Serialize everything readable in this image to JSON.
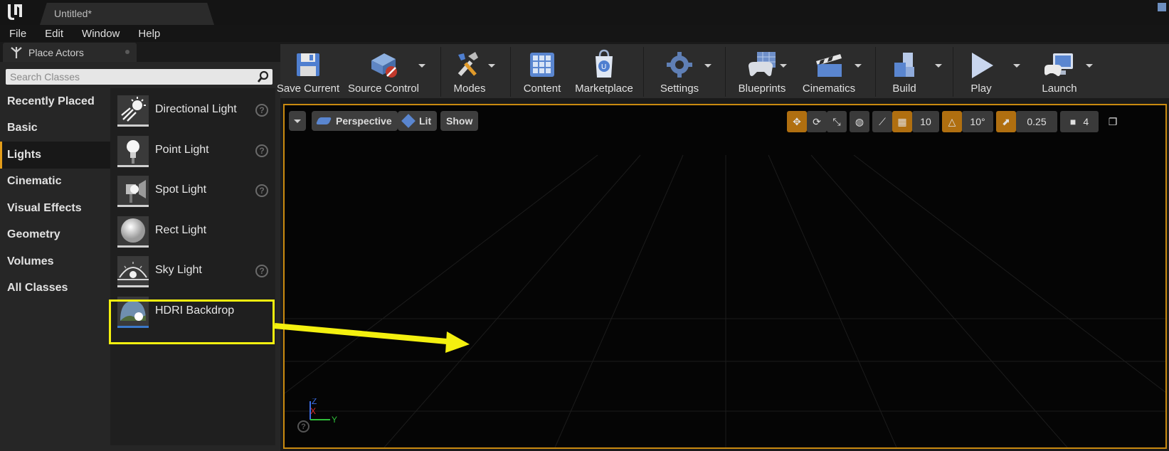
{
  "title_bar": {
    "tab_title": "Untitled*"
  },
  "menu": [
    "File",
    "Edit",
    "Window",
    "Help"
  ],
  "place_actors": {
    "tab_label": "Place Actors",
    "search_placeholder": "Search Classes",
    "categories": [
      "Recently Placed",
      "Basic",
      "Lights",
      "Cinematic",
      "Visual Effects",
      "Geometry",
      "Volumes",
      "All Classes"
    ],
    "active_category": "Lights",
    "items": [
      {
        "name": "Directional Light",
        "icon": "directional-light-icon",
        "help": true
      },
      {
        "name": "Point Light",
        "icon": "point-light-icon",
        "help": true
      },
      {
        "name": "Spot Light",
        "icon": "spot-light-icon",
        "help": true
      },
      {
        "name": "Rect Light",
        "icon": "rect-light-icon",
        "help": false
      },
      {
        "name": "Sky Light",
        "icon": "sky-light-icon",
        "help": true
      },
      {
        "name": "HDRI Backdrop",
        "icon": "hdri-backdrop-icon",
        "help": false
      }
    ]
  },
  "toolbar": {
    "save_current": "Save Current",
    "source_control": "Source Control",
    "modes": "Modes",
    "content": "Content",
    "marketplace": "Marketplace",
    "settings": "Settings",
    "blueprints": "Blueprints",
    "cinematics": "Cinematics",
    "build": "Build",
    "play": "Play",
    "launch": "Launch"
  },
  "viewport": {
    "perspective": "Perspective",
    "lit": "Lit",
    "show": "Show",
    "grid_snap": "10",
    "rotation_snap": "10°",
    "scale_snap": "0.25",
    "camera_speed": "4",
    "axis_z": "Z",
    "axis_x": "X",
    "axis_y": "Y"
  },
  "colors": {
    "accent": "#e39d1a",
    "highlight": "#f4f00f",
    "viewport_border": "#c98a10"
  }
}
